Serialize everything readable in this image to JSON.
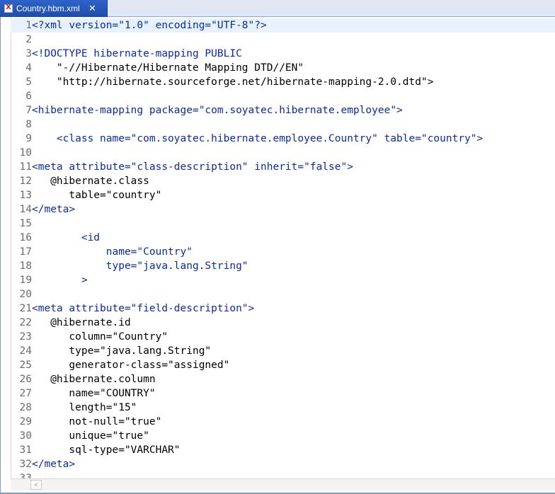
{
  "tab": {
    "title": "Country.hbm.xml",
    "close_glyph": "✕"
  },
  "editor": {
    "lines": [
      {
        "num": "1",
        "code": "<?xml version=\"1.0\" encoding=\"UTF-8\"?>",
        "kind": "tag",
        "current": true
      },
      {
        "num": "2",
        "code": "",
        "kind": "plain"
      },
      {
        "num": "3",
        "code": "<!DOCTYPE hibernate-mapping PUBLIC",
        "kind": "tag"
      },
      {
        "num": "4",
        "code": "    \"-//Hibernate/Hibernate Mapping DTD//EN\"",
        "kind": "plain"
      },
      {
        "num": "5",
        "code": "    \"http://hibernate.sourceforge.net/hibernate-mapping-2.0.dtd\">",
        "kind": "plain"
      },
      {
        "num": "6",
        "code": "",
        "kind": "plain"
      },
      {
        "num": "7",
        "code": "<hibernate-mapping package=\"com.soyatec.hibernate.employee\">",
        "kind": "tag"
      },
      {
        "num": "8",
        "code": "",
        "kind": "plain"
      },
      {
        "num": "9",
        "code": "    <class name=\"com.soyatec.hibernate.employee.Country\" table=\"country\">",
        "kind": "tag"
      },
      {
        "num": "10",
        "code": "",
        "kind": "plain"
      },
      {
        "num": "11",
        "code": "<meta attribute=\"class-description\" inherit=\"false\">",
        "kind": "tag"
      },
      {
        "num": "12",
        "code": "   @hibernate.class",
        "kind": "plain"
      },
      {
        "num": "13",
        "code": "      table=\"country\"",
        "kind": "plain"
      },
      {
        "num": "14",
        "code": "</meta>",
        "kind": "tag"
      },
      {
        "num": "15",
        "code": "",
        "kind": "plain"
      },
      {
        "num": "16",
        "code": "        <id",
        "kind": "tag"
      },
      {
        "num": "17",
        "code": "            name=\"Country\"",
        "kind": "tag"
      },
      {
        "num": "18",
        "code": "            type=\"java.lang.String\"",
        "kind": "tag"
      },
      {
        "num": "19",
        "code": "        >",
        "kind": "tag"
      },
      {
        "num": "20",
        "code": "",
        "kind": "plain"
      },
      {
        "num": "21",
        "code": "<meta attribute=\"field-description\">",
        "kind": "tag"
      },
      {
        "num": "22",
        "code": "   @hibernate.id",
        "kind": "plain"
      },
      {
        "num": "23",
        "code": "      column=\"Country\"",
        "kind": "plain"
      },
      {
        "num": "24",
        "code": "      type=\"java.lang.String\"",
        "kind": "plain"
      },
      {
        "num": "25",
        "code": "      generator-class=\"assigned\"",
        "kind": "plain"
      },
      {
        "num": "26",
        "code": "   @hibernate.column",
        "kind": "plain"
      },
      {
        "num": "27",
        "code": "      name=\"COUNTRY\"",
        "kind": "plain"
      },
      {
        "num": "28",
        "code": "      length=\"15\"",
        "kind": "plain"
      },
      {
        "num": "29",
        "code": "      not-null=\"true\"",
        "kind": "plain"
      },
      {
        "num": "30",
        "code": "      unique=\"true\"",
        "kind": "plain"
      },
      {
        "num": "31",
        "code": "      sql-type=\"VARCHAR\"",
        "kind": "plain"
      },
      {
        "num": "32",
        "code": "</meta>",
        "kind": "tag"
      },
      {
        "num": "33",
        "code": "",
        "kind": "plain"
      }
    ]
  },
  "scrollbar": {
    "left_arrow": "<"
  },
  "colors": {
    "tag": "#0a2aa8",
    "plain": "#000000",
    "line_number": "#6b6b6b",
    "current_line": "#e8f2fe",
    "tab_bg": "#2f63c9"
  }
}
